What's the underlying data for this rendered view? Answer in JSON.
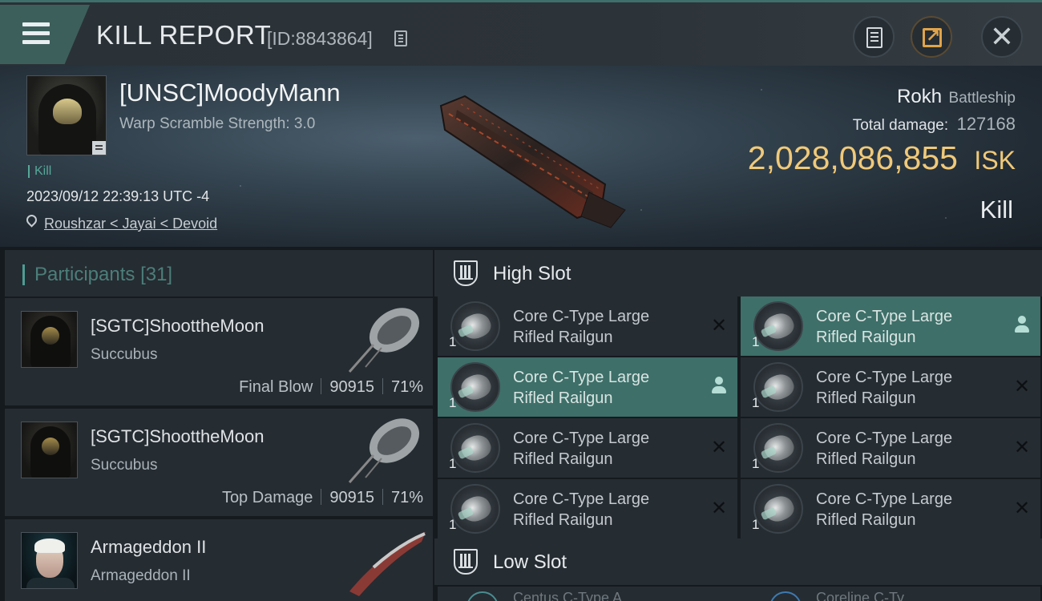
{
  "header": {
    "title": "KILL REPORT",
    "report_id": "[ID:8843864]",
    "icons": [
      "menu-icon",
      "copy-icon",
      "clipboard-icon",
      "share-icon",
      "close-icon"
    ]
  },
  "victim": {
    "name": "[UNSC]MoodyMann",
    "warp_scramble": "Warp Scramble Strength: 3.0",
    "tag": "Kill",
    "timestamp": "2023/09/12 22:39:13 UTC -4",
    "location": "Roushzar < Jayai < Devoid",
    "ship_name": "Rokh",
    "ship_class": "Battleship",
    "total_damage_label": "Total damage:",
    "total_damage_value": "127168",
    "isk_value": "2,028,086,855",
    "isk_unit": "ISK",
    "result": "Kill"
  },
  "participants": {
    "title": "Participants",
    "count": "[31]",
    "items": [
      {
        "name": "[SGTC]ShoottheMoon",
        "ship": "Succubus",
        "label": "Final Blow",
        "damage": "90915",
        "percent": "71%"
      },
      {
        "name": "[SGTC]ShoottheMoon",
        "ship": "Succubus",
        "label": "Top Damage",
        "damage": "90915",
        "percent": "71%"
      },
      {
        "name": "Armageddon II",
        "ship": "Armageddon II"
      }
    ]
  },
  "fittings": {
    "high_slot_title": "High Slot",
    "low_slot_title": "Low Slot",
    "modules": [
      {
        "qty": "1",
        "line1": "Core C-Type Large",
        "line2": "Rifled Railgun",
        "state": "destroyed",
        "icon": "close-icon"
      },
      {
        "qty": "1",
        "line1": "Core C-Type Large",
        "line2": "Rifled Railgun",
        "state": "dropped",
        "icon": "user-icon"
      },
      {
        "qty": "1",
        "line1": "Core C-Type Large",
        "line2": "Rifled Railgun",
        "state": "dropped",
        "icon": "user-icon"
      },
      {
        "qty": "1",
        "line1": "Core C-Type Large",
        "line2": "Rifled Railgun",
        "state": "destroyed",
        "icon": "close-icon"
      },
      {
        "qty": "1",
        "line1": "Core C-Type Large",
        "line2": "Rifled Railgun",
        "state": "destroyed",
        "icon": "close-icon"
      },
      {
        "qty": "1",
        "line1": "Core C-Type Large",
        "line2": "Rifled Railgun",
        "state": "destroyed",
        "icon": "close-icon"
      },
      {
        "qty": "1",
        "line1": "Core C-Type Large",
        "line2": "Rifled Railgun",
        "state": "destroyed",
        "icon": "close-icon"
      },
      {
        "qty": "1",
        "line1": "Core C-Type Large",
        "line2": "Rifled Railgun",
        "state": "destroyed",
        "icon": "close-icon"
      }
    ],
    "low_slot_peek": [
      "Centus C-Type A",
      "Coreline C-Ty"
    ]
  },
  "colors": {
    "accent_teal": "#3e6f69",
    "isk_gold": "#f0c979",
    "panel": "#252c32",
    "background": "#151a1f"
  }
}
